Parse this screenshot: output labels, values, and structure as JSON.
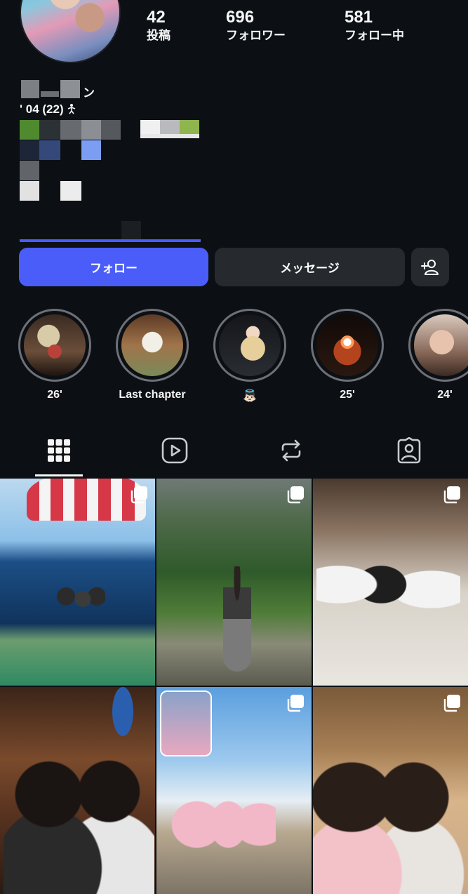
{
  "profile": {
    "stats": [
      {
        "value": "42",
        "label": "投稿"
      },
      {
        "value": "696",
        "label": "フォロワー"
      },
      {
        "value": "581",
        "label": "フォロー中"
      }
    ],
    "bio_name_fragment": "ン",
    "bio_age_line": "' 04 (22) "
  },
  "actions": {
    "follow_label": "フォロー",
    "message_label": "メッセージ",
    "add_user_icon": "add-user-icon"
  },
  "highlights": [
    {
      "label": "26'"
    },
    {
      "label": "Last chapter"
    },
    {
      "label": "👼🏻"
    },
    {
      "label": "25'"
    },
    {
      "label": "24'"
    }
  ],
  "tabs": [
    {
      "icon": "grid-icon",
      "active": true
    },
    {
      "icon": "reels-icon",
      "active": false
    },
    {
      "icon": "reposts-icon",
      "active": false
    },
    {
      "icon": "tagged-icon",
      "active": false
    }
  ],
  "colors": {
    "background": "#0c1014",
    "follow_button": "#4a5df9",
    "secondary_button": "#262a2f"
  }
}
